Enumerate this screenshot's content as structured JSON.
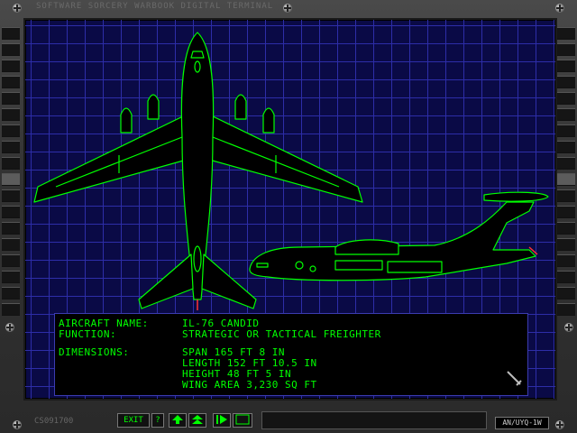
{
  "header": {
    "title": "SOFTWARE SORCERY WARBOOK DIGITAL TERMINAL"
  },
  "aircraft": {
    "name_label": "AIRCRAFT NAME:",
    "name_value": "IL-76 CANDID",
    "function_label": "FUNCTION:",
    "function_value": "STRATEGIC OR TACTICAL FREIGHTER",
    "dimensions_label": "DIMENSIONS:",
    "span": "SPAN 165 FT 8 IN",
    "length": "LENGTH 152 FT 10.5 IN",
    "height": "HEIGHT 48 FT 5 IN",
    "wing_area": "WING AREA 3,230 SQ FT"
  },
  "footer": {
    "serial": "CS091700",
    "exit_label": "EXIT",
    "help_label": "?",
    "model_label": "AN/UYQ-1W"
  },
  "icons": {
    "help": "question-icon",
    "up": "up-arrow-icon",
    "top": "top-arrow-icon",
    "next": "next-icon",
    "screen": "screen-icon",
    "close": "sword-icon"
  },
  "colors": {
    "wireframe": "#00ff00",
    "grid": "#2d2da8",
    "screen_bg": "#0a0a46",
    "text": "#00ff00"
  }
}
